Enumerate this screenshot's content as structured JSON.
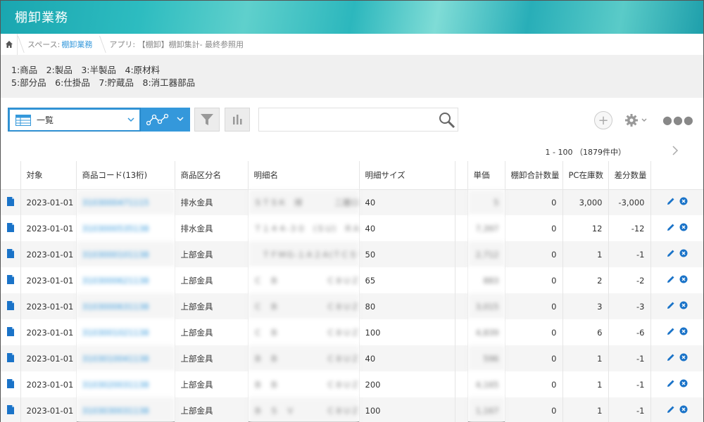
{
  "header": {
    "title": "棚卸業務"
  },
  "breadcrumb": {
    "space_prefix": "スペース:",
    "space_name": "棚卸業務",
    "app_label": "アプリ: 【棚卸】棚卸集計- 最終参照用"
  },
  "notice": {
    "line1": "1:商品　2:製品　3:半製品　4:原材料",
    "line2": "5:部分品　6:仕掛品　7:貯蔵品　8:消工器部品"
  },
  "toolbar": {
    "view_name": "一覧",
    "search_placeholder": ""
  },
  "pager": {
    "range": "1 - 100 （1879件中）"
  },
  "table": {
    "columns": [
      "対象",
      "商品コード(13桁)",
      "商品区分名",
      "明細名",
      "明細サイズ",
      "",
      "単価",
      "棚卸合計数量",
      "PC在庫数",
      "差分数量"
    ],
    "rows": [
      {
        "date": "2023-01-01",
        "code": "3103000471115",
        "category": "排水金具",
        "name": "ＳＴＳＫ　排　　　　二層ロング－",
        "size": "40",
        "price": "5",
        "total": "0",
        "pc": "3,000",
        "diff": "-3,000"
      },
      {
        "date": "2023-01-01",
        "code": "3103000535138",
        "category": "排水金具",
        "name": "Ｔ１４４-３０　(ＳＵ)　ＲＡＬＰワン",
        "size": "40",
        "price": "7,397",
        "total": "0",
        "pc": "12",
        "diff": "-12"
      },
      {
        "date": "2023-01-01",
        "code": "3103000101138",
        "category": "上部金具",
        "name": "　ＴＦＭＧ-１Ａ２Ａ(ＴＣＳテレー",
        "size": "50",
        "price": "2,712",
        "total": "0",
        "pc": "1",
        "diff": "-1"
      },
      {
        "date": "2023-01-01",
        "code": "3103000621138",
        "category": "上部金具",
        "name": "Ｃ　Ｂ　　　　　　Ｃ８ＵＺ　２４－",
        "size": "65",
        "price": "883",
        "total": "0",
        "pc": "2",
        "diff": "-2"
      },
      {
        "date": "2023-01-01",
        "code": "3103000631138",
        "category": "上部金具",
        "name": "Ｃ　Ｂ　　　　　　Ｃ８ＵＺ　２４－",
        "size": "80",
        "price": "3,015",
        "total": "0",
        "pc": "3",
        "diff": "-3"
      },
      {
        "date": "2023-01-01",
        "code": "3103001021138",
        "category": "上部金具",
        "name": "Ｃ　Ｂ　　　　　　Ｃ８ＵＺ　２４－",
        "size": "100",
        "price": "4,839",
        "total": "0",
        "pc": "6",
        "diff": "-6"
      },
      {
        "date": "2023-01-01",
        "code": "3103010041138",
        "category": "上部金具",
        "name": "Ｂ　Ｂ　　　　　　Ｃ８ＵＺ　２４－",
        "size": "40",
        "price": "596",
        "total": "0",
        "pc": "1",
        "diff": "-1"
      },
      {
        "date": "2023-01-01",
        "code": "3103020031138",
        "category": "上部金具",
        "name": "Ｂ　Ｂ　　　　　　Ｃ８ＵＺ　　－",
        "size": "200",
        "price": "4,165",
        "total": "0",
        "pc": "1",
        "diff": "-1"
      },
      {
        "date": "2023-01-01",
        "code": "3103030031138",
        "category": "上部金具",
        "name": "Ｂ　Ｓ　Ｖ　　　　Ｃ８ＵＺ　２４－",
        "size": "100",
        "price": "1,167",
        "total": "0",
        "pc": "1",
        "diff": "-1"
      }
    ]
  },
  "colors": {
    "accent": "#3498db",
    "icon": "#1a73c8",
    "header": "#2cb7bd"
  }
}
